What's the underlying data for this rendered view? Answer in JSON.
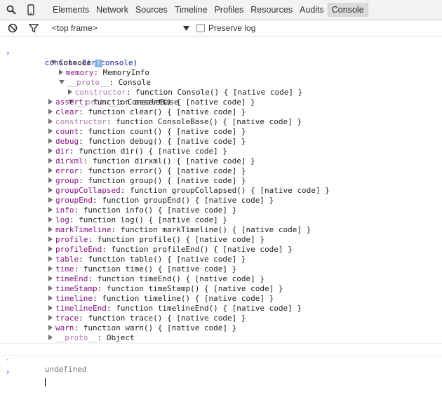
{
  "toolbar": {
    "tabs": [
      {
        "label": "Elements"
      },
      {
        "label": "Network"
      },
      {
        "label": "Sources"
      },
      {
        "label": "Timeline"
      },
      {
        "label": "Profiles"
      },
      {
        "label": "Resources"
      },
      {
        "label": "Audits"
      },
      {
        "label": "Console"
      }
    ],
    "active_tab": "Console"
  },
  "filterbar": {
    "frame_select": "<top frame>",
    "preserve_log_label": "Preserve log",
    "preserve_log_checked": false
  },
  "console": {
    "command": "console.dir(console)",
    "root_label": "Console",
    "memory": {
      "key": "memory",
      "value": "MemoryInfo"
    },
    "proto1": {
      "key": "__proto__",
      "value": "Console"
    },
    "constructor1": {
      "key": "constructor",
      "value": "function Console() { [native code] }"
    },
    "proto2": {
      "key": "__proto__",
      "value": "ConsoleBase"
    },
    "methods": [
      {
        "key": "assert",
        "value": "function assert() { [native code] }",
        "dim": false
      },
      {
        "key": "clear",
        "value": "function clear() { [native code] }",
        "dim": false
      },
      {
        "key": "constructor",
        "value": "function ConsoleBase() { [native code] }",
        "dim": true
      },
      {
        "key": "count",
        "value": "function count() { [native code] }",
        "dim": false
      },
      {
        "key": "debug",
        "value": "function debug() { [native code] }",
        "dim": false
      },
      {
        "key": "dir",
        "value": "function dir() { [native code] }",
        "dim": false
      },
      {
        "key": "dirxml",
        "value": "function dirxml() { [native code] }",
        "dim": false
      },
      {
        "key": "error",
        "value": "function error() { [native code] }",
        "dim": false
      },
      {
        "key": "group",
        "value": "function group() { [native code] }",
        "dim": false
      },
      {
        "key": "groupCollapsed",
        "value": "function groupCollapsed() { [native code] }",
        "dim": false
      },
      {
        "key": "groupEnd",
        "value": "function groupEnd() { [native code] }",
        "dim": false
      },
      {
        "key": "info",
        "value": "function info() { [native code] }",
        "dim": false
      },
      {
        "key": "log",
        "value": "function log() { [native code] }",
        "dim": false
      },
      {
        "key": "markTimeline",
        "value": "function markTimeline() { [native code] }",
        "dim": false
      },
      {
        "key": "profile",
        "value": "function profile() { [native code] }",
        "dim": false
      },
      {
        "key": "profileEnd",
        "value": "function profileEnd() { [native code] }",
        "dim": false
      },
      {
        "key": "table",
        "value": "function table() { [native code] }",
        "dim": false
      },
      {
        "key": "time",
        "value": "function time() { [native code] }",
        "dim": false
      },
      {
        "key": "timeEnd",
        "value": "function timeEnd() { [native code] }",
        "dim": false
      },
      {
        "key": "timeStamp",
        "value": "function timeStamp() { [native code] }",
        "dim": false
      },
      {
        "key": "timeline",
        "value": "function timeline() { [native code] }",
        "dim": false
      },
      {
        "key": "timelineEnd",
        "value": "function timelineEnd() { [native code] }",
        "dim": false
      },
      {
        "key": "trace",
        "value": "function trace() { [native code] }",
        "dim": false
      },
      {
        "key": "warn",
        "value": "function warn() { [native code] }",
        "dim": false
      },
      {
        "key": "__proto__",
        "value": "Object",
        "dim": true
      }
    ],
    "result": "undefined",
    "colors": {
      "key": "#881280",
      "key_dim": "#b07ab0",
      "command": "#1a1aa6",
      "prompt": "#367cf1"
    }
  }
}
